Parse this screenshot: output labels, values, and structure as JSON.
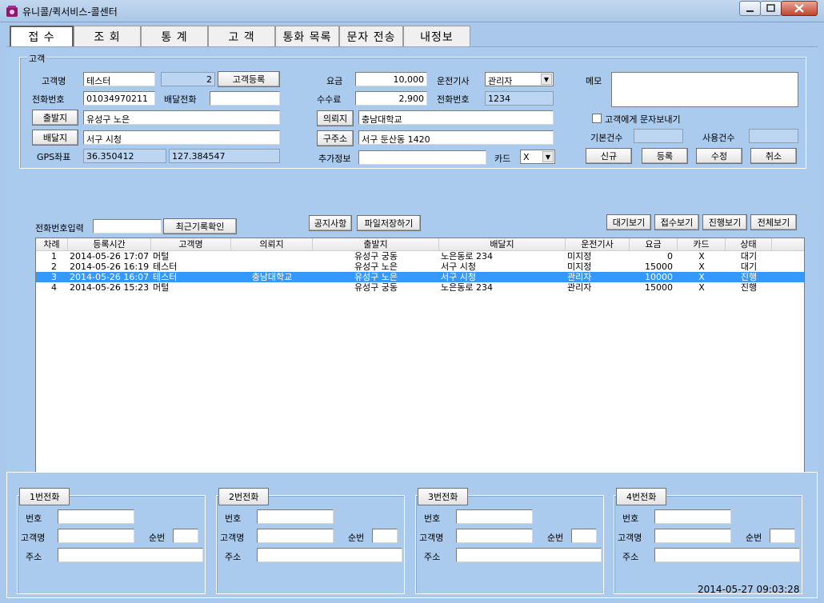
{
  "window": {
    "title": "유니콜/퀵서비스-콜센터"
  },
  "tabs": [
    {
      "label": "접 수",
      "active": true
    },
    {
      "label": "조 회"
    },
    {
      "label": "통 계"
    },
    {
      "label": "고 객"
    },
    {
      "label": "통화 목록"
    },
    {
      "label": "문자 전송"
    },
    {
      "label": "내정보"
    }
  ],
  "customer": {
    "group_label": "고객",
    "name_label": "고객명",
    "name_value": "테스터",
    "count_value": "2",
    "register_button": "고객등록",
    "phone_label": "전화번호",
    "phone_value": "01034970211",
    "delivery_phone_label": "배달전화",
    "delivery_phone_value": "",
    "origin_button": "출발지",
    "origin_value": "유성구 노은",
    "dest_button": "배달지",
    "dest_value": "서구 시청",
    "gps_label": "GPS좌표",
    "gps_lat": "36.350412",
    "gps_lng": "127.384547",
    "fee_label": "요금",
    "fee_value": "10,000",
    "commission_label": "수수료",
    "commission_value": "2,900",
    "requester_button": "의뢰지",
    "requester_value": "충남대학교",
    "old_address_button": "구주소",
    "old_address_value": "서구 둔산동 1420",
    "extra_label": "추가정보",
    "extra_value": "",
    "driver_label": "운전기사",
    "driver_value": "관리자",
    "driver_phone_label": "전화번호",
    "driver_phone_value": "1234",
    "card_label": "카드",
    "card_value": "X",
    "memo_label": "메모",
    "sms_checkbox_label": "고객에게 문자보내기",
    "base_count_label": "기본건수",
    "used_count_label": "사용건수",
    "new_button": "신규",
    "save_button": "등록",
    "edit_button": "수정",
    "cancel_button": "취소"
  },
  "toolbar": {
    "phone_input_label": "전화번호입력",
    "recent_button": "최근기록확인",
    "notice_button": "공지사항",
    "file_save_button": "파일저장하기",
    "wait_view_button": "대기보기",
    "accept_view_button": "접수보기",
    "progress_view_button": "진행보기",
    "all_view_button": "전체보기"
  },
  "grid": {
    "columns": [
      "차례",
      "등록시간",
      "고객명",
      "의뢰지",
      "출발지",
      "배달지",
      "운전기사",
      "요금",
      "카드",
      "상태"
    ],
    "rows": [
      [
        "1",
        "2014-05-26 17:07",
        "머털",
        "",
        "유성구 궁동",
        "노은동로 234",
        "미지정",
        "0",
        "X",
        "대기"
      ],
      [
        "2",
        "2014-05-26 16:19",
        "테스터",
        "",
        "유성구 노은",
        "서구 시청",
        "미지정",
        "15000",
        "X",
        "대기"
      ],
      [
        "3",
        "2014-05-26 16:07",
        "테스터",
        "충남대학교",
        "유성구 노은",
        "서구 시청",
        "관리자",
        "10000",
        "X",
        "진행"
      ],
      [
        "4",
        "2014-05-26 15:23",
        "머털",
        "",
        "유성구 궁동",
        "노은동로 234",
        "관리자",
        "15000",
        "X",
        "진행"
      ]
    ],
    "selected_row": 2
  },
  "phones": [
    {
      "title": "1번전화",
      "number_label": "번호",
      "name_label": "고객명",
      "order_label": "순번",
      "address_label": "주소"
    },
    {
      "title": "2번전화",
      "number_label": "번호",
      "name_label": "고객명",
      "order_label": "순번",
      "address_label": "주소"
    },
    {
      "title": "3번전화",
      "number_label": "번호",
      "name_label": "고객명",
      "order_label": "순번",
      "address_label": "주소"
    },
    {
      "title": "4번전화",
      "number_label": "번호",
      "name_label": "고객명",
      "order_label": "순번",
      "address_label": "주소"
    }
  ],
  "status": {
    "datetime": "2014-05-27 09:03:28"
  }
}
